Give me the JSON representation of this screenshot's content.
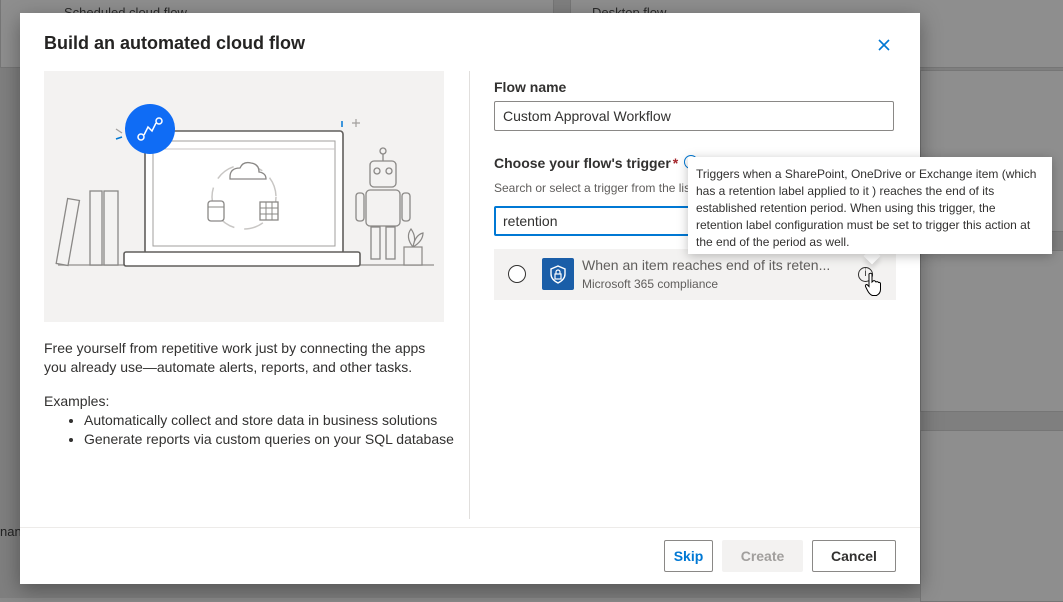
{
  "background": {
    "card_left_title": "Scheduled cloud flow",
    "card_right_title": "Desktop flow",
    "left_edge_text": "nan"
  },
  "dialog": {
    "title": "Build an automated cloud flow",
    "close_icon": "close-icon",
    "description": "Free yourself from repetitive work just by connecting the apps you already use—automate alerts, reports, and other tasks.",
    "examples_heading": "Examples:",
    "examples": [
      "Automatically collect and store data in business solutions",
      "Generate reports via custom queries on your SQL database"
    ],
    "flow_name_label": "Flow name",
    "flow_name_value": "Custom Approval Workflow",
    "trigger_label": "Choose your flow's trigger",
    "required_mark": "*",
    "search_hint": "Search or select a trigger from the list",
    "search_value": "retention",
    "trigger_result": {
      "title": "When an item reaches end of its reten...",
      "connector": "Microsoft 365 compliance",
      "icon": "shield-lock-icon",
      "info_glyph": "i"
    },
    "tooltip": "Triggers when a SharePoint, OneDrive or Exchange item (which has a retention label applied to it ) reaches the end of its established retention period. When using this trigger, the retention label configuration must be set to trigger this action at the end of the period as well.",
    "buttons": {
      "skip": "Skip",
      "create": "Create",
      "cancel": "Cancel"
    }
  },
  "colors": {
    "accent": "#0078d4",
    "connector": "#1a5ea8",
    "required": "#a4262c"
  }
}
